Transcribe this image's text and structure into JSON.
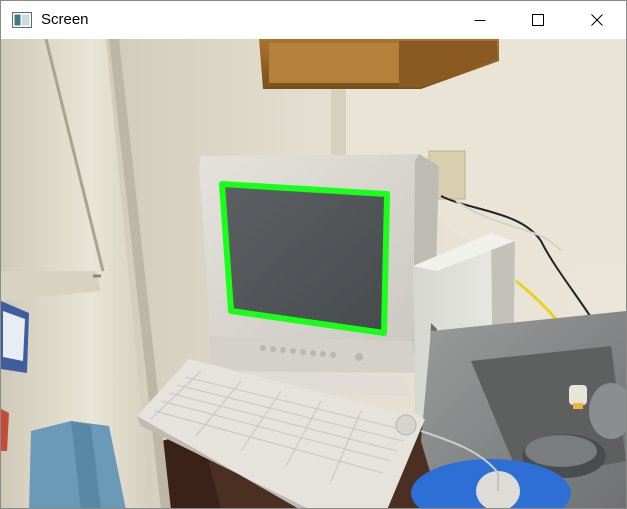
{
  "window": {
    "title": "Screen",
    "icon": "app-window-icon",
    "controls": {
      "minimize_icon": "minimize-icon",
      "maximize_icon": "maximize-icon",
      "close_icon": "close-icon"
    }
  },
  "image": {
    "description_icon": "photo-image",
    "highlight_color": "#19ff1a"
  }
}
